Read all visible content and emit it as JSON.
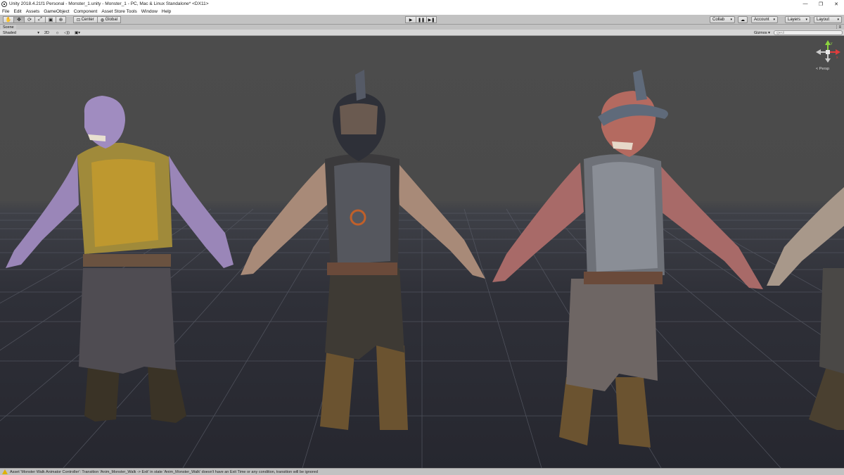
{
  "window": {
    "title": "Unity 2018.4.21f1 Personal - Monster_1.unity - Monster_1 - PC, Mac & Linux Standalone* <DX11>",
    "controls": {
      "minimize": "—",
      "maximize": "❐",
      "close": "✕"
    }
  },
  "menubar": {
    "items": [
      "File",
      "Edit",
      "Assets",
      "GameObject",
      "Component",
      "Asset Store Tools",
      "Window",
      "Help"
    ]
  },
  "toolbar": {
    "tools": [
      {
        "icon": "hand-icon",
        "glyph": "✋"
      },
      {
        "icon": "move-icon",
        "glyph": "✥"
      },
      {
        "icon": "rotate-icon",
        "glyph": "⟳"
      },
      {
        "icon": "scale-icon",
        "glyph": "⤢"
      },
      {
        "icon": "rect-icon",
        "glyph": "▣"
      },
      {
        "icon": "transform-icon",
        "glyph": "⊕"
      }
    ],
    "pivot": {
      "center": "Center",
      "global": "Global",
      "center_icon": "⊡",
      "global_icon": "◍"
    },
    "play": {
      "play": "▶",
      "pause": "❚❚",
      "step": "▶❚"
    },
    "collab": "Collab",
    "cloud_icon": "☁",
    "account": "Account",
    "layers": "Layers",
    "layout": "Layout",
    "caret": "▾"
  },
  "scene_tab": {
    "label": "Scene",
    "menu": "⋮≡"
  },
  "scene_toolbar": {
    "shading_mode": "Shaded",
    "mode_2d": "2D",
    "lighting_icon": "☼",
    "audio_icon": "◁))",
    "effects_icon": "▣▾",
    "gizmos": "Gizmos",
    "search_placeholder": "Q▾All"
  },
  "viewport": {
    "projection": "< Persp",
    "gizmo_axes": {
      "y": "y",
      "x": "x",
      "z": "z"
    },
    "colors": {
      "x_axis": "#e23c3c",
      "y_axis": "#8cd43f",
      "z_axis": "#3f7fe2"
    }
  },
  "statusbar": {
    "message": "Asset 'Monster Walk Animator Controller': Transition 'Anim_Monster_Walk -> Exit' in state 'Anim_Monster_Walk' doesn't have an Exit Time or any condition, transition will be ignored"
  },
  "characters": [
    {
      "name": "purple-monster"
    },
    {
      "name": "helmeted-gladiator"
    },
    {
      "name": "red-skull-gladiator"
    },
    {
      "name": "partial-gladiator"
    }
  ]
}
